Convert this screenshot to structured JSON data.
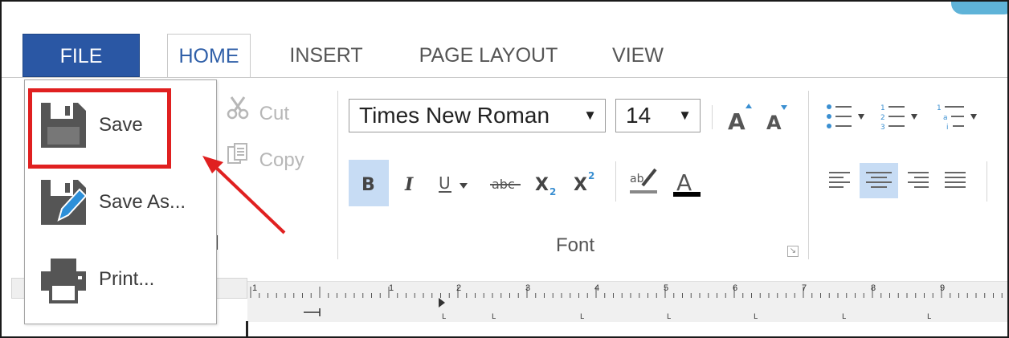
{
  "tabs": {
    "file": "FILE",
    "home": "HOME",
    "insert": "INSERT",
    "page_layout": "PAGE LAYOUT",
    "view": "VIEW"
  },
  "file_menu": {
    "items": [
      {
        "label": "Save",
        "icon": "save-icon"
      },
      {
        "label": "Save As...",
        "icon": "save-as-icon"
      },
      {
        "label": "Print...",
        "icon": "print-icon"
      }
    ]
  },
  "clipboard": {
    "cut": "Cut",
    "copy": "Copy"
  },
  "font": {
    "family": "Times New Roman",
    "size": "14",
    "group_label": "Font"
  },
  "ruler": {
    "numbers": [
      "1",
      "1",
      "2",
      "3",
      "4",
      "5",
      "6",
      "7",
      "8",
      "9"
    ]
  },
  "colors": {
    "file_tab": "#2a57a4",
    "home_tab_text": "#2f5fa8",
    "highlight": "#e02020",
    "active_button": "#c7dcf4"
  }
}
